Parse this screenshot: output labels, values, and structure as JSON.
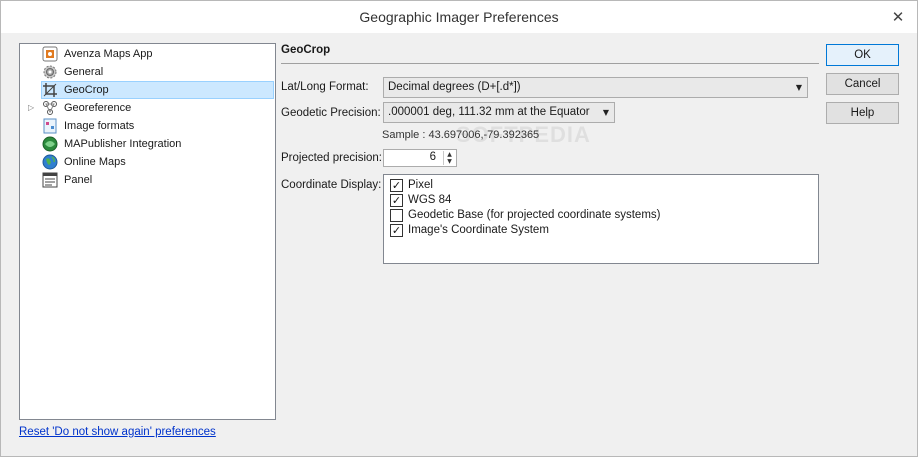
{
  "window": {
    "title": "Geographic Imager Preferences",
    "close_glyph": "✕"
  },
  "tree": {
    "items": [
      {
        "label": "Avenza Maps App",
        "icon": "avenza-maps-icon"
      },
      {
        "label": "General",
        "icon": "gear-icon"
      },
      {
        "label": "GeoCrop",
        "icon": "crop-icon",
        "selected": true
      },
      {
        "label": "Georeference",
        "icon": "georeference-icon",
        "expandable": true
      },
      {
        "label": "Image formats",
        "icon": "image-formats-icon"
      },
      {
        "label": "MAPublisher Integration",
        "icon": "mapublisher-icon"
      },
      {
        "label": "Online Maps",
        "icon": "globe-icon"
      },
      {
        "label": "Panel",
        "icon": "panel-icon"
      }
    ]
  },
  "reset_link": "Reset 'Do not show again' preferences",
  "geocrop": {
    "title": "GeoCrop",
    "latlong_label": "Lat/Long Format:",
    "latlong_value": "Decimal degrees (D+[.d*])",
    "precision_label": "Geodetic Precision:",
    "precision_value": ".000001 deg, 111.32 mm at the Equator",
    "sample": "Sample : 43.697006,-79.392365",
    "projected_label": "Projected precision:",
    "projected_value": "6",
    "coord_label": "Coordinate Display:",
    "coord_options": [
      {
        "label": "Pixel",
        "checked": true
      },
      {
        "label": "WGS 84",
        "checked": true
      },
      {
        "label": "Geodetic Base (for projected coordinate systems)",
        "checked": false
      },
      {
        "label": "Image's Coordinate System",
        "checked": true
      }
    ]
  },
  "buttons": {
    "ok": "OK",
    "cancel": "Cancel",
    "help": "Help"
  },
  "watermark": "SOFTPEDIA"
}
